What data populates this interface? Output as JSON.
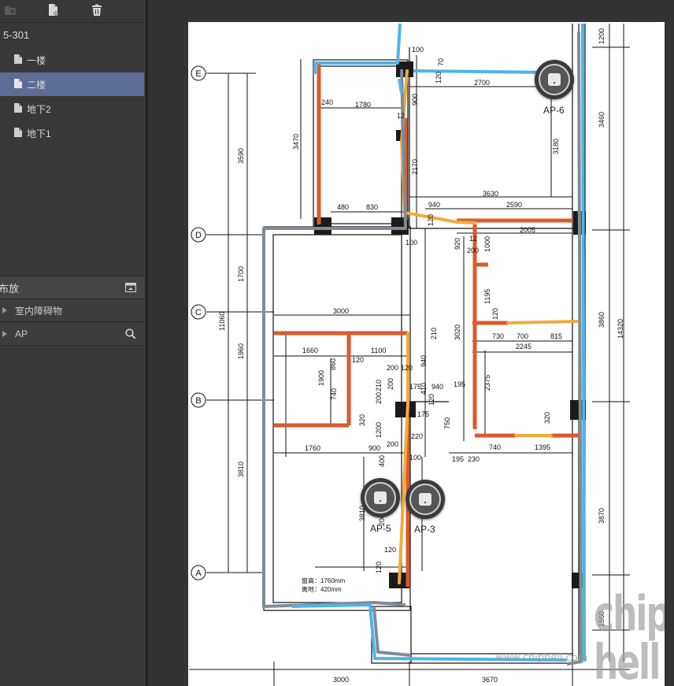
{
  "sidebar": {
    "toolbar": {
      "icons": [
        "new-folder-icon",
        "new-file-icon",
        "delete-icon"
      ]
    },
    "tree": {
      "root": "5-301",
      "items": [
        {
          "label": "一楼",
          "selected": false
        },
        {
          "label": "二楼",
          "selected": true
        },
        {
          "label": "地下2",
          "selected": false
        },
        {
          "label": "地下1",
          "selected": false
        }
      ]
    },
    "panel": {
      "title": "布放",
      "groups": [
        {
          "label": "室内障碍物"
        },
        {
          "label": "AP"
        }
      ]
    }
  },
  "floorplan": {
    "aps": [
      {
        "label": "AP-6"
      },
      {
        "label": "AP-5"
      },
      {
        "label": "AP-3"
      }
    ],
    "axis_labels": [
      "E",
      "D",
      "C",
      "B",
      "A"
    ],
    "dims": {
      "d100a": "100",
      "d70": "70",
      "d120a": "120",
      "d2700": "2700",
      "d1200": "1200",
      "d240": "240",
      "d1780a": "1780",
      "d900a": "900",
      "d12": "12",
      "d3470": "3470",
      "d3590": "3590",
      "d3460": "3460",
      "d3180": "3180",
      "d2170": "2170",
      "d3630": "3630",
      "d940a": "940",
      "d2590": "2590",
      "d480": "480",
      "d830": "830",
      "d120b": "120",
      "d100b": "100",
      "d2005": "2005",
      "d920": "920",
      "d12b": "12",
      "d200a": "200",
      "d1000": "1000",
      "d1700": "1700",
      "d1195": "1195",
      "d3000a": "3000",
      "d11060": "11060",
      "d120c": "120",
      "d3860": "3860",
      "d14320": "14320",
      "d210a": "210",
      "d1660": "1660",
      "d1100": "1100",
      "d860": "860",
      "d120d": "120",
      "d730": "730",
      "d700": "700",
      "d815": "815",
      "d2245": "2245",
      "d3020": "3020",
      "d940b": "940",
      "d1960": "1960",
      "d200b": "200",
      "d120e": "120",
      "d1900": "1900",
      "d740a": "740",
      "d175a": "175",
      "d410": "410",
      "d940c": "940",
      "d195a": "195",
      "d200c": "200",
      "d210b": "210",
      "d200d": "200",
      "d120f": "120",
      "d2375": "2375",
      "d175b": "175",
      "d320a": "320",
      "d1200b": "1200",
      "d220": "220",
      "d750": "750",
      "d320b": "320",
      "d195b": "195",
      "d230": "230",
      "d740b": "740",
      "d1395": "1395",
      "d1760": "1760",
      "d900b": "900",
      "d200e": "200",
      "d100c": "100",
      "d3810": "3810",
      "d400": "400",
      "d3870": "3870",
      "d3810b": "3810",
      "d200f": "200",
      "d120g": "120",
      "d120h": "120",
      "d1560": "1560",
      "d3000b": "3000",
      "d3670": "3670"
    },
    "notes": {
      "window_height": "窗高：1760mm",
      "sill_height": "离地：420mm"
    },
    "colors": {
      "network_blue": "#4fb3ea",
      "cable_orange": "#f0ab3e",
      "wall_red": "#dd5a2a",
      "pipe_gray": "#7f8c95"
    }
  },
  "watermark": {
    "logo_text": "chip hell",
    "url": "www.chiphell.com"
  }
}
